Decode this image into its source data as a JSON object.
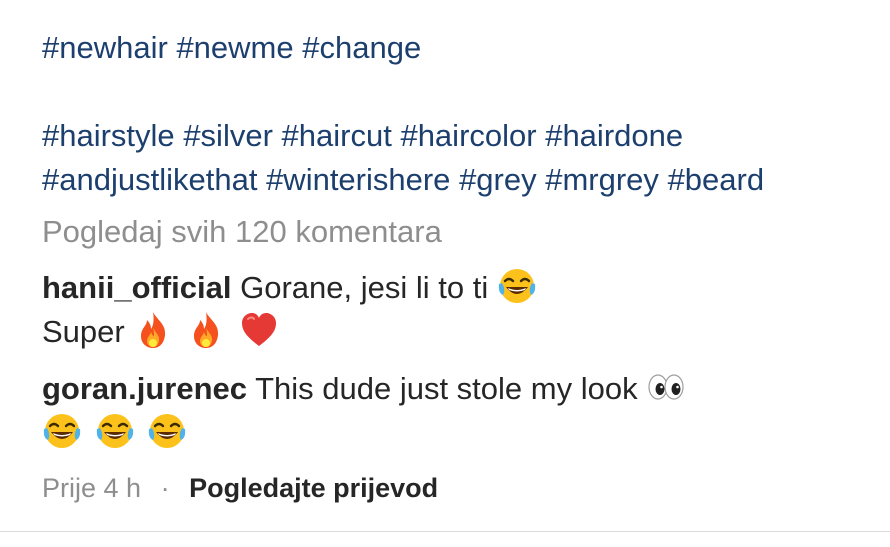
{
  "hashtags": {
    "line1": [
      "#newhair",
      "#newme",
      "#change"
    ],
    "line2": [
      "#hairstyle",
      "#silver",
      "#haircut",
      "#haircolor",
      "#hairdone"
    ],
    "line3": [
      "#andjustlikethat",
      "#winterishere",
      "#grey",
      "#mrgrey",
      "#beard"
    ]
  },
  "view_all_comments": "Pogledaj svih 120 komentara",
  "comments": [
    {
      "username": "hanii_official",
      "text_line1": "Gorane, jesi li to ti",
      "line1_emojis": [
        "tears-of-joy-emoji"
      ],
      "text_line2": "Super",
      "line2_emojis": [
        "fire-emoji",
        "fire-emoji",
        "red-heart-emoji"
      ]
    },
    {
      "username": "goran.jurenec",
      "text_line1": "This dude just stole my look",
      "line1_emojis": [
        "eyes-emoji"
      ],
      "text_line2": "",
      "line2_emojis": [
        "tears-of-joy-emoji",
        "tears-of-joy-emoji",
        "tears-of-joy-emoji"
      ]
    }
  ],
  "meta": {
    "time": "Prije 4 h",
    "separator": "·",
    "translate_label": "Pogledajte prijevod"
  },
  "colors": {
    "hashtag": "#1c3f6e",
    "secondary_text": "#8e8e8e",
    "primary_text": "#262626",
    "divider": "#dbdbdb"
  }
}
